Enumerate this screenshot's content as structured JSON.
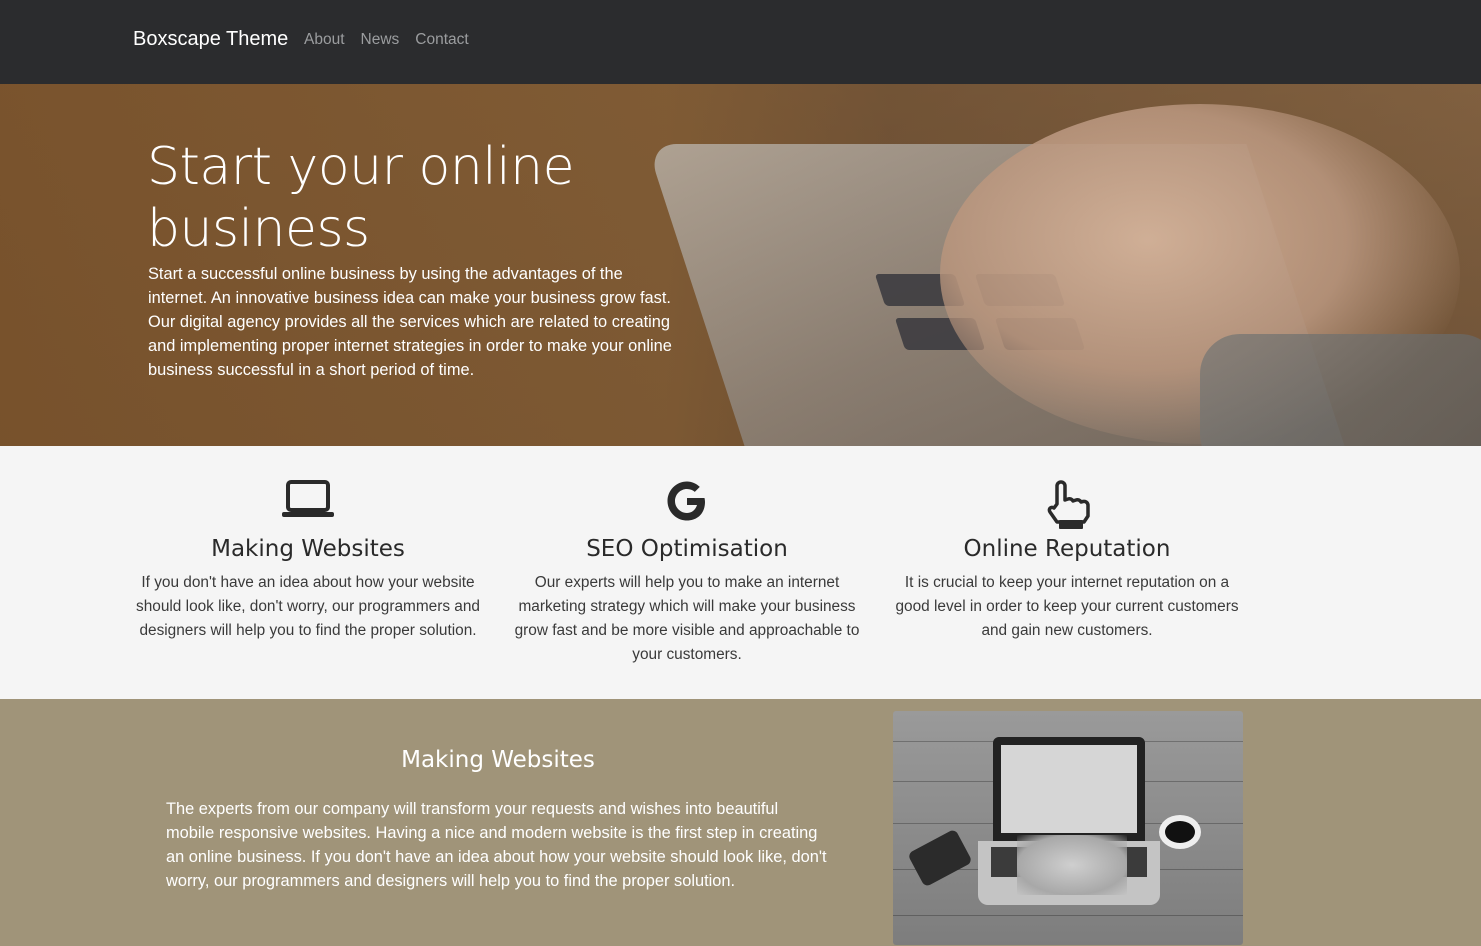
{
  "navbar": {
    "brand": "Boxscape Theme",
    "links": [
      "About",
      "News",
      "Contact"
    ]
  },
  "hero": {
    "title": "Start your online business",
    "text": "Start a successful online business by using the advantages of the internet. An innovative business idea can make your business grow fast. Our digital agency provides all the services which are related to creating and implementing proper internet strategies in order to make your online business successful in a short period of time."
  },
  "features": [
    {
      "icon": "laptop-icon",
      "title": "Making Websites",
      "text": "If you don't have an idea about how your website should look like, don't worry, our programmers and designers will help you to find the proper solution."
    },
    {
      "icon": "google-icon",
      "title": "SEO Optimisation",
      "text": "Our experts will help you to make an internet marketing strategy which will make your business grow fast and be more visible and approachable to your customers."
    },
    {
      "icon": "hand-pointer-icon",
      "title": "Online Reputation",
      "text": "It is crucial to keep your internet reputation on a good level in order to keep your current customers and gain new customers."
    }
  ],
  "detail": {
    "title": "Making Websites",
    "text": "The experts from our company will transform your requests and wishes into beautiful mobile responsive websites. Having a nice and modern website is the first step in creating an online business. If you don't have an idea about how your website should look like, don't worry, our programmers and designers will help you to find the proper solution."
  },
  "colors": {
    "navbar": "#2b2c2e",
    "features_bg": "#f5f5f5",
    "detail_bg": "#a09479"
  }
}
